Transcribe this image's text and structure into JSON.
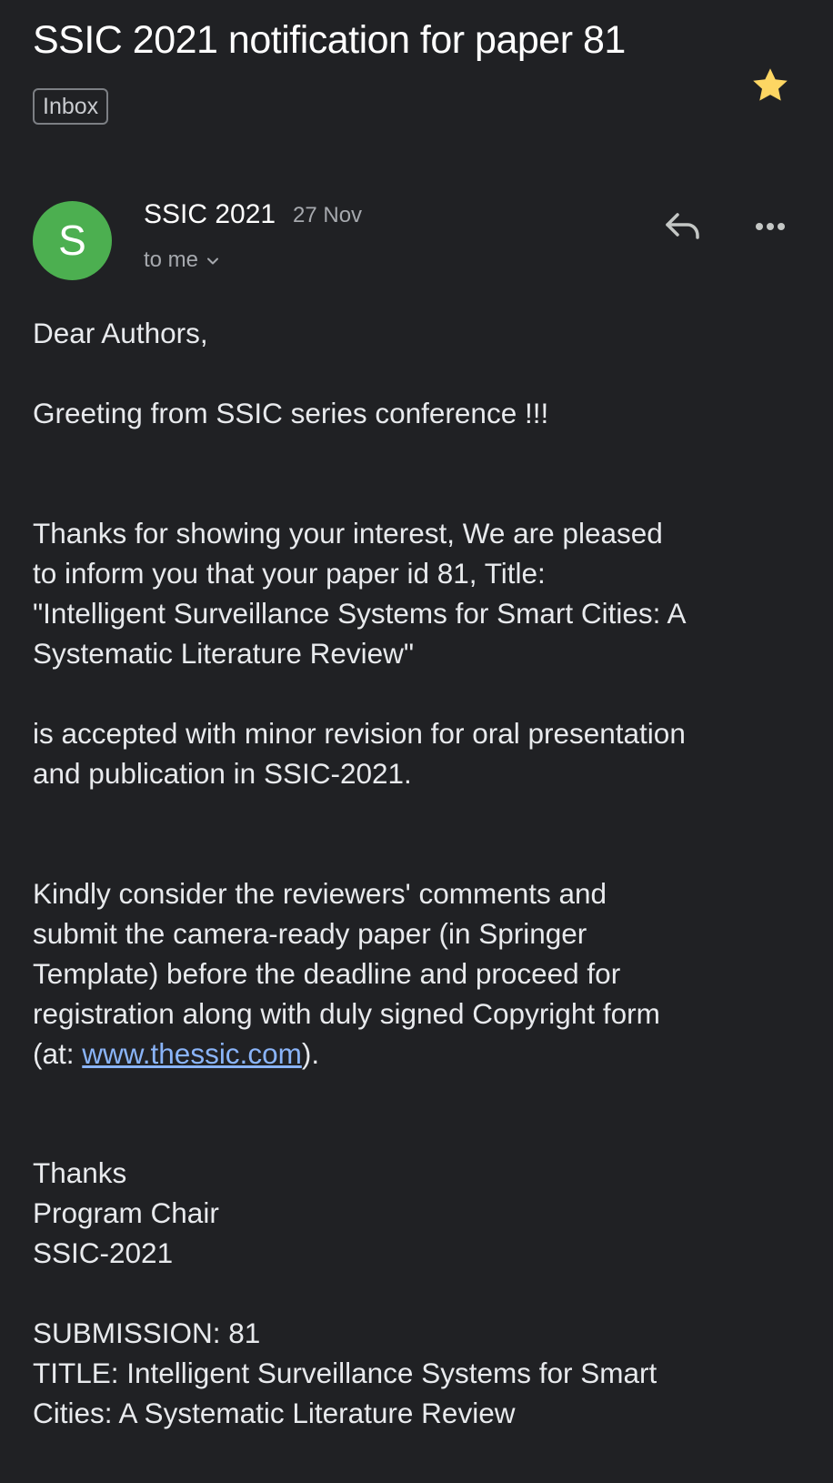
{
  "email": {
    "subject": "SSIC 2021 notification for paper 81",
    "label": "Inbox",
    "starred": true,
    "star_color": "#fdd663",
    "icons": {
      "star": "star-icon",
      "reply": "reply-icon",
      "more": "more-options-icon",
      "expand": "chevron-down-icon"
    },
    "sender": {
      "initial": "S",
      "name": "SSIC 2021",
      "date": "27 Nov",
      "recipients": "to me",
      "avatar_color": "#4caf50"
    },
    "body": {
      "greeting": "Dear Authors,",
      "greeting_line": "Greeting from SSIC series conference !!!",
      "para1": [
        "Thanks for showing your interest, We are pleased",
        "to inform you that your paper id  81, Title:",
        "\"Intelligent Surveillance Systems for Smart Cities: A",
        "Systematic Literature Review\""
      ],
      "para2": [
        "is accepted with minor revision for oral presentation",
        "and publication in SSIC-2021."
      ],
      "para3": [
        "Kindly consider the reviewers' comments and",
        "submit the camera-ready paper (in Springer",
        "Template) before the deadline and proceed for",
        "registration along with duly signed Copyright form"
      ],
      "para3_last_prefix": "(at: ",
      "link_text": "www.thessic.com",
      "link_color": "#8ab4f8",
      "para3_last_suffix": ").",
      "signoff": [
        "Thanks",
        "Program Chair",
        "SSIC-2021"
      ],
      "submission": [
        "SUBMISSION: 81",
        "TITLE: Intelligent Surveillance Systems for Smart",
        "Cities: A Systematic Literature Review"
      ]
    }
  }
}
